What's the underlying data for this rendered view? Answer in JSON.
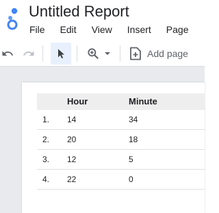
{
  "app": {
    "title": "Untitled Report",
    "brand_color": "#4285f4"
  },
  "menu": [
    {
      "label": "File"
    },
    {
      "label": "Edit"
    },
    {
      "label": "View"
    },
    {
      "label": "Insert"
    },
    {
      "label": "Page"
    }
  ],
  "toolbar": {
    "undo_icon": "undo-icon",
    "redo_icon": "redo-icon",
    "select_icon": "pointer-icon",
    "zoom_icon": "zoom-in-icon",
    "add_page_label": "Add page",
    "select_active_color": "#e8f0fe"
  },
  "table": {
    "columns": [
      "",
      "Hour",
      "Minute"
    ],
    "rows": [
      {
        "index": "1.",
        "hour": "14",
        "minute": "34"
      },
      {
        "index": "2.",
        "hour": "20",
        "minute": "18"
      },
      {
        "index": "3.",
        "hour": "12",
        "minute": "5"
      },
      {
        "index": "4.",
        "hour": "22",
        "minute": "0"
      }
    ]
  }
}
